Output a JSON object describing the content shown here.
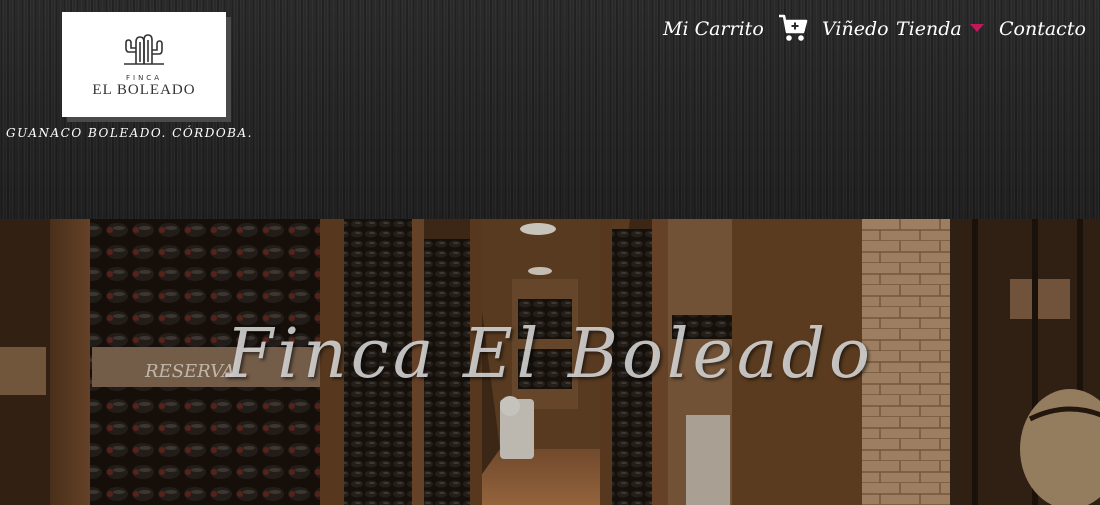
{
  "brand": {
    "logo_small_text": "FINCA",
    "logo_name": "EL BOLEADO",
    "tagline": "GUANACO BOLEADO. CÓRDOBA."
  },
  "nav": {
    "cart_label": "Mi Carrito",
    "cart_icon": "shopping-cart-icon",
    "vineyard_label": "Viñedo",
    "shop_label": "Tienda",
    "shop_dropdown_icon": "caret-down-icon",
    "contact_label": "Contacto",
    "accent_color": "#c2185b"
  },
  "hero": {
    "title": "Finca El Boleado",
    "image_subject": "wine cellar with bottle racks"
  }
}
